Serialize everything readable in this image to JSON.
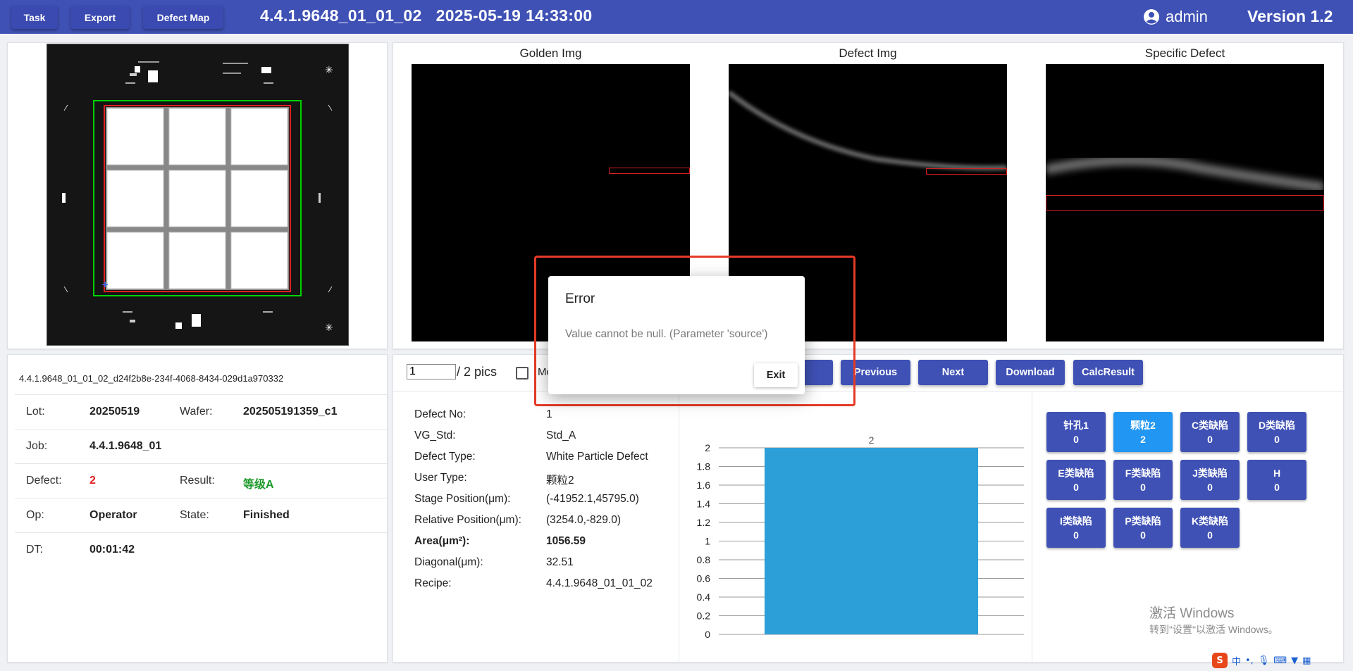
{
  "topbar": {
    "buttons": [
      "Task",
      "Export",
      "Defect Map"
    ],
    "title": "4.4.1.9648_01_01_02   2025-05-19 14:33:00",
    "user": "admin",
    "version": "Version 1.2"
  },
  "images": {
    "golden_title": "Golden Img",
    "defect_title": "Defect Img",
    "specific_title": "Specific Defect"
  },
  "info": {
    "id": "4.4.1.9648_01_01_02_d24f2b8e-234f-4068-8434-029d1a970332",
    "lot_label": "Lot:",
    "lot": "20250519",
    "wafer_label": "Wafer:",
    "wafer": "202505191359_c1",
    "job_label": "Job:",
    "job": "4.4.1.9648_01",
    "defect_label": "Defect:",
    "defect": "2",
    "result_label": "Result:",
    "result": "等级A",
    "op_label": "Op:",
    "op": "Operator",
    "state_label": "State:",
    "state": "Finished",
    "dt_label": "DT:",
    "dt": "00:01:42"
  },
  "controls": {
    "page_value": "1",
    "page_total": "/ 2 pics",
    "checkbox_label": "Mo",
    "buttons": [
      "Previous",
      "Next",
      "Download",
      "CalcResult"
    ]
  },
  "details": [
    {
      "label": "Defect No:",
      "value": "1"
    },
    {
      "label": "VG_Std:",
      "value": "Std_A"
    },
    {
      "label": "Defect Type:",
      "value": "White Particle Defect"
    },
    {
      "label": "User Type:",
      "value": "颗粒2"
    },
    {
      "label": "Stage Position(μm):",
      "value": "(-41952.1,45795.0)"
    },
    {
      "label": "Relative Position(μm):",
      "value": "(3254.0,-829.0)"
    },
    {
      "label": "Area(μm²):",
      "value": "1056.59"
    },
    {
      "label": "Diagonal(μm):",
      "value": "32.51"
    },
    {
      "label": "Recipe:",
      "value": "4.4.1.9648_01_01_02"
    }
  ],
  "chart_data": {
    "type": "bar",
    "categories": [
      ""
    ],
    "values": [
      2
    ],
    "data_labels": [
      "2"
    ],
    "ylim": [
      0,
      2
    ],
    "yticks": [
      "2",
      "1.8",
      "1.6",
      "1.4",
      "1.2",
      "1",
      "0.8",
      "0.6",
      "0.4",
      "0.2",
      "0"
    ],
    "color": "#2d9fd8",
    "grid": true
  },
  "defect_buttons": [
    {
      "name": "针孔1",
      "count": "0"
    },
    {
      "name": "颗粒2",
      "count": "2"
    },
    {
      "name": "C类缺陷",
      "count": "0"
    },
    {
      "name": "D类缺陷",
      "count": "0"
    },
    {
      "name": "E类缺陷",
      "count": "0"
    },
    {
      "name": "F类缺陷",
      "count": "0"
    },
    {
      "name": "J类缺陷",
      "count": "0"
    },
    {
      "name": "H",
      "count": "0"
    },
    {
      "name": "I类缺陷",
      "count": "0"
    },
    {
      "name": "P类缺陷",
      "count": "0"
    },
    {
      "name": "K类缺陷",
      "count": "0"
    }
  ],
  "dialog": {
    "title": "Error",
    "message": "Value cannot be null. (Parameter 'source')",
    "exit": "Exit"
  },
  "watermark": {
    "line1": "激活 Windows",
    "line2": "转到\"设置\"以激活 Windows。"
  },
  "tray": {
    "ime": "中"
  },
  "colors": {
    "accent": "#3f51b5",
    "active": "#2196f3",
    "bar": "#2d9fd8",
    "error_red": "#e53a26"
  }
}
